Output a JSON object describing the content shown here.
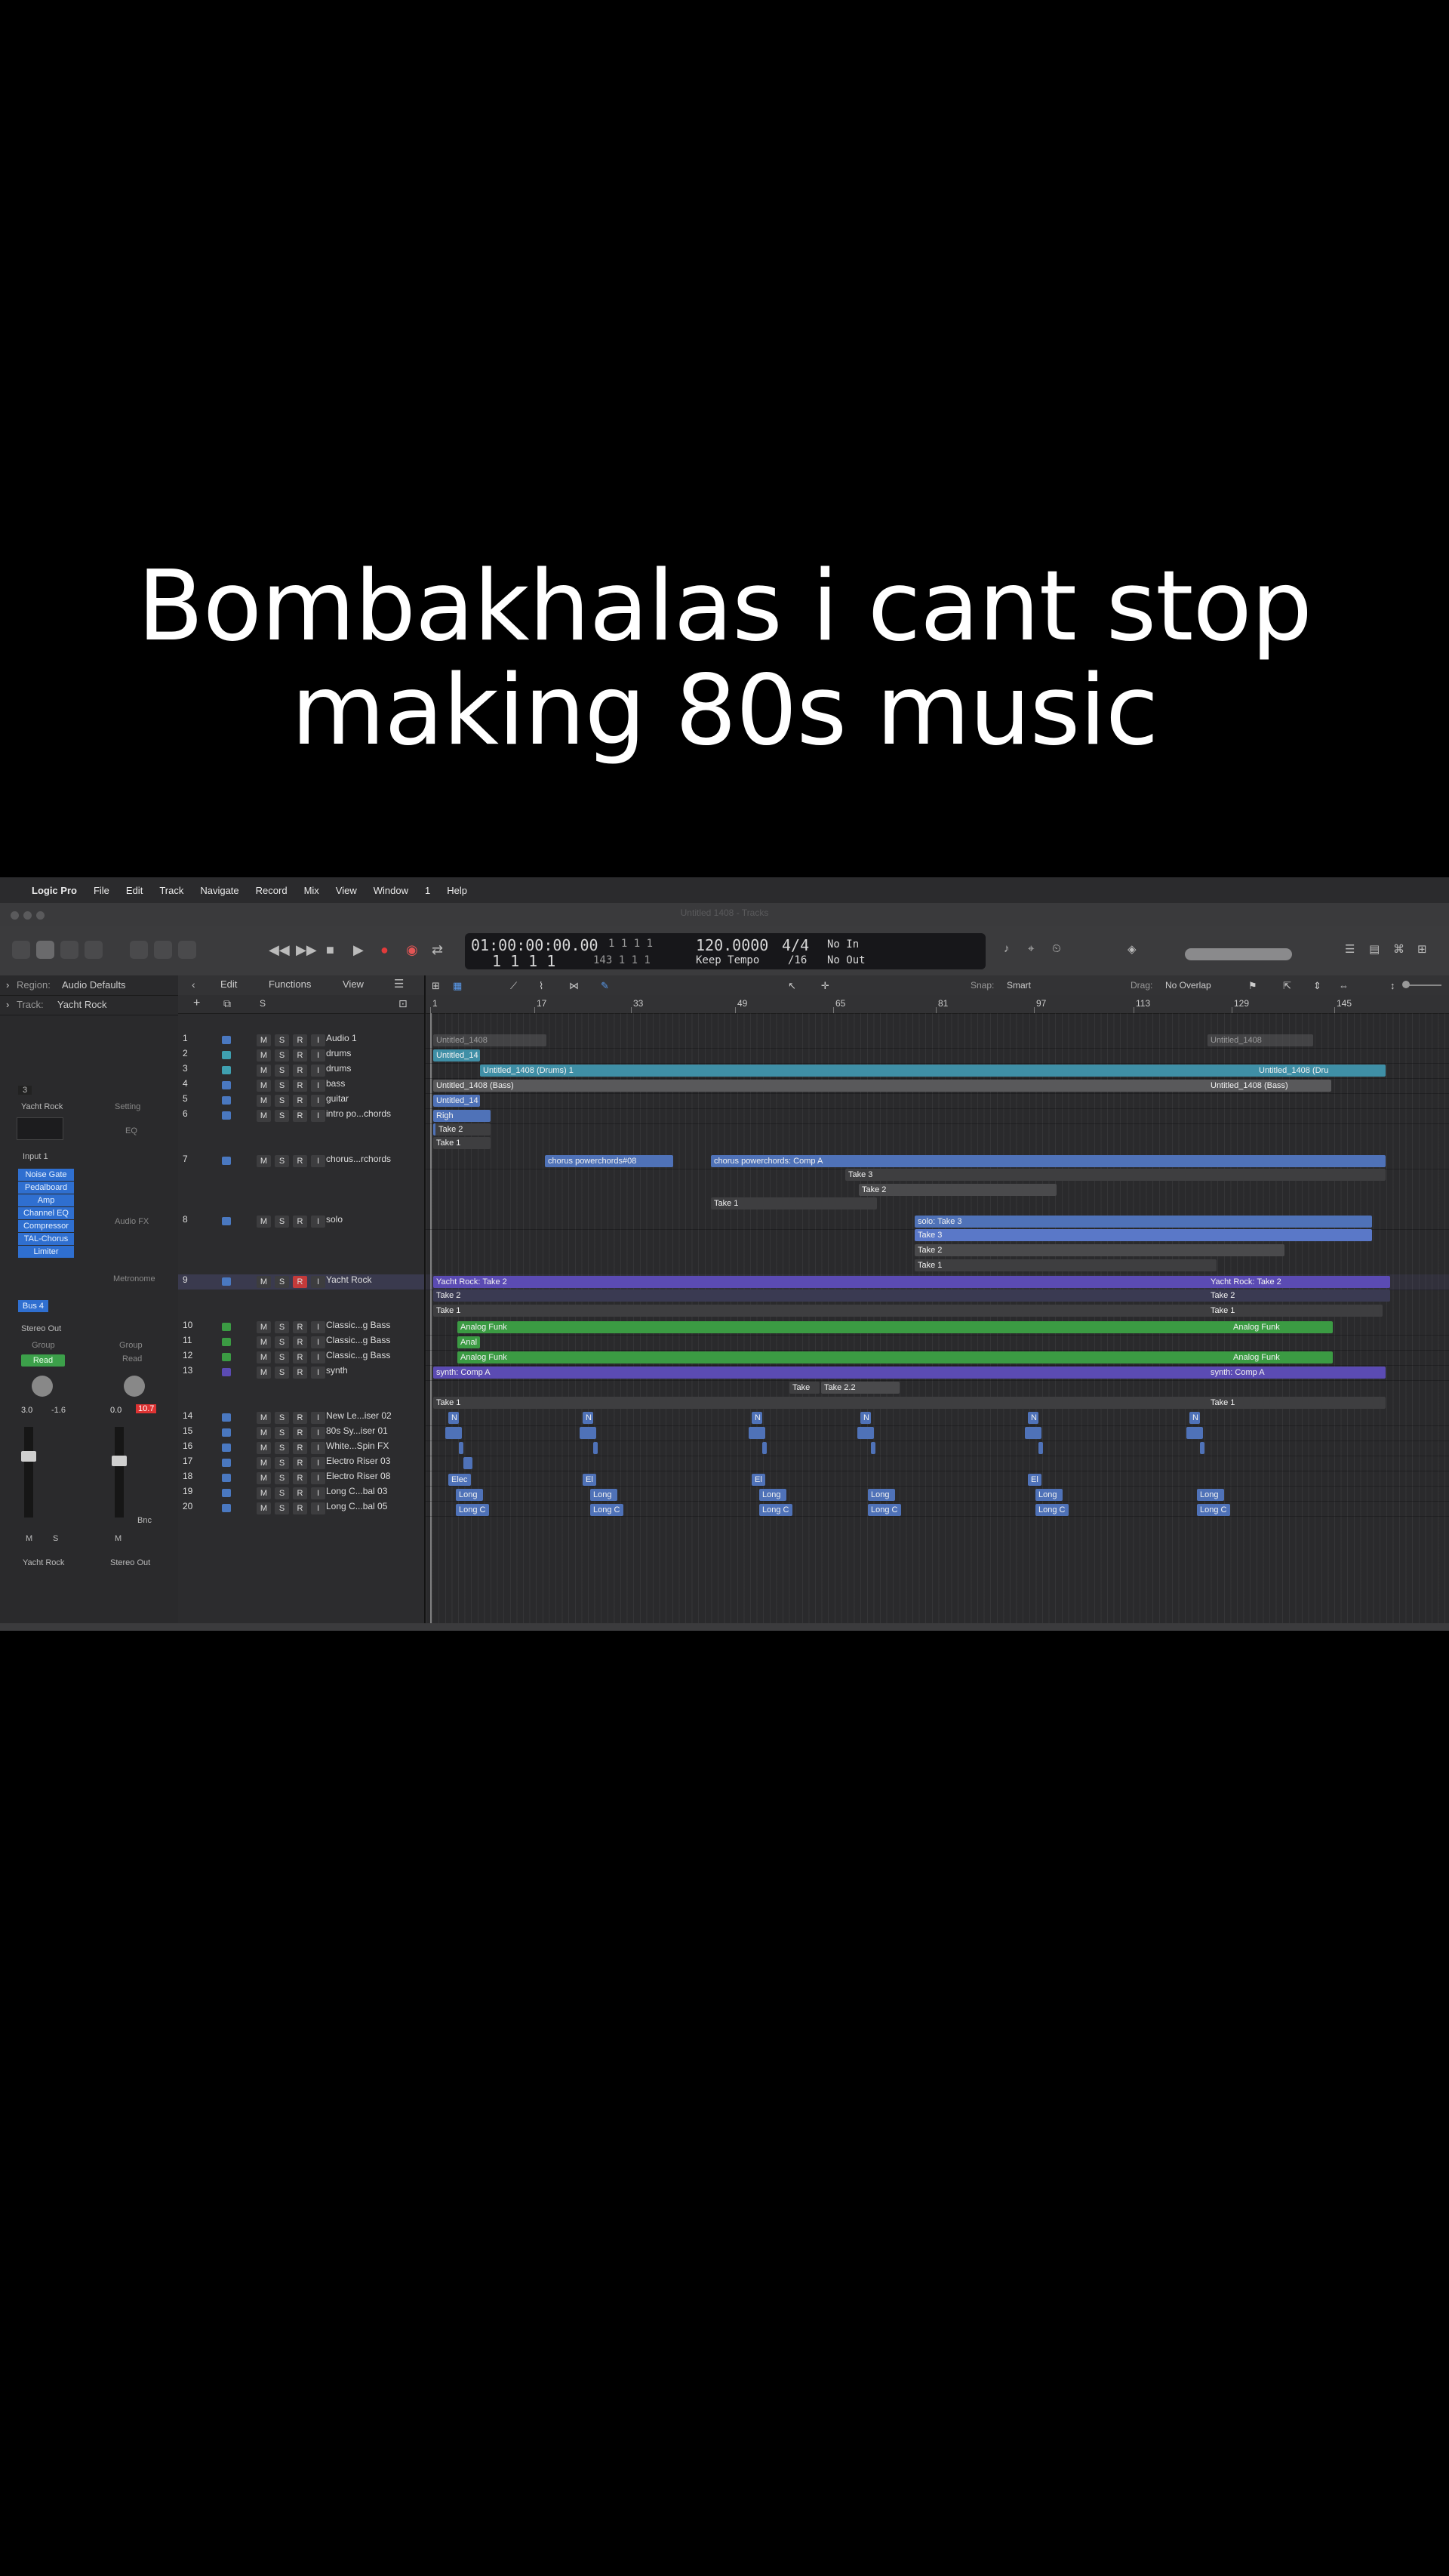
{
  "caption": {
    "line1": "Bombakhalas i cant stop",
    "line2": "making 80s music"
  },
  "menubar": {
    "app": "Logic Pro",
    "items": [
      "File",
      "Edit",
      "Track",
      "Navigate",
      "Record",
      "Mix",
      "View",
      "Window",
      "1",
      "Help"
    ]
  },
  "titlebar": {
    "title": "Untitled 1408 - Tracks"
  },
  "lcd": {
    "time": "01:00:00:00.00",
    "bars_top": "1  1  1     1",
    "bars_bottom": "1  1  1     1",
    "end_bars": "143  1  1     1",
    "tempo": "120.0000",
    "tempo_mode": "Keep Tempo",
    "signature": "4/4",
    "division": "/16",
    "in": "No In",
    "out": "No Out"
  },
  "inspector": {
    "region_label": "Region:",
    "region_value": "Audio Defaults",
    "track_label": "Track:",
    "track_value": "Yacht Rock",
    "strip1": {
      "name": "Yacht Rock",
      "input": "Input 1",
      "plugins": [
        "Noise Gate",
        "Pedalboard",
        "Amp",
        "Channel EQ",
        "Compressor",
        "TAL-Chorus",
        "Limiter"
      ],
      "send": "Bus 4",
      "output": "Stereo Out",
      "group": "Group",
      "automation": "Read",
      "vol": "3.0",
      "peak": "-1.6",
      "bottom_label": "Yacht Rock"
    },
    "strip2": {
      "setting": "Setting",
      "eq": "EQ",
      "audio_fx": "Audio FX",
      "metronome": "Metronome",
      "group": "Group",
      "automation": "Read",
      "vol": "0.0",
      "peak": "10.7",
      "bnc": "Bnc",
      "bottom_label": "Stereo Out"
    }
  },
  "arrange_toolbar": {
    "edit": "Edit",
    "functions": "Functions",
    "view": "View",
    "snap_label": "Snap:",
    "snap_value": "Smart",
    "drag_label": "Drag:",
    "drag_value": "No Overlap"
  },
  "ruler": [
    "1",
    "17",
    "33",
    "49",
    "65",
    "81",
    "97",
    "113",
    "129",
    "145"
  ],
  "colors": {
    "blue": "#4f72b8",
    "teal": "#3f8fa6",
    "purple": "#5b4bb3",
    "green": "#3b9b43",
    "gray": "#59595b",
    "accent": "#2f6fd0"
  },
  "tracks": [
    {
      "num": "1",
      "name": "Audio 1"
    },
    {
      "num": "2",
      "name": "drums"
    },
    {
      "num": "3",
      "name": "drums"
    },
    {
      "num": "4",
      "name": "bass"
    },
    {
      "num": "5",
      "name": "guitar"
    },
    {
      "num": "6",
      "name": "intro po...chords"
    },
    {
      "num": "7",
      "name": "chorus...rchords"
    },
    {
      "num": "8",
      "name": "solo"
    },
    {
      "num": "9",
      "name": "Yacht Rock"
    },
    {
      "num": "10",
      "name": "Classic...g Bass"
    },
    {
      "num": "11",
      "name": "Classic...g Bass"
    },
    {
      "num": "12",
      "name": "Classic...g Bass"
    },
    {
      "num": "13",
      "name": "synth"
    },
    {
      "num": "14",
      "name": "New Le...iser 02"
    },
    {
      "num": "15",
      "name": "80s Sy...iser 01"
    },
    {
      "num": "16",
      "name": "White...Spin FX"
    },
    {
      "num": "17",
      "name": "Electro Riser 03"
    },
    {
      "num": "18",
      "name": "Electro Riser 08"
    },
    {
      "num": "19",
      "name": "Long C...bal 03"
    },
    {
      "num": "20",
      "name": "Long C...bal 05"
    }
  ],
  "regions": {
    "r1a": "Untitled_1408",
    "r1b": "Untitled_1408",
    "r2": "Untitled_14",
    "r3a": "Untitled_1408 (Drums) 1",
    "r3b": "Untitled_1408 (Dru",
    "r4a": "Untitled_1408 (Bass)",
    "r4b": "Untitled_1408 (Bass)",
    "r5": "Untitled_14",
    "r6": "Righ",
    "r6t2": "Take 2",
    "r6t1": "Take 1",
    "r7a": "chorus powerchords#08",
    "r7b": "chorus powerchords: Comp A",
    "r7t3": "Take 3",
    "r7t2": "Take 2",
    "r7t1": "Take 1",
    "r8": "solo: Take 3",
    "r8t3": "Take 3",
    "r8t2": "Take 2",
    "r8t1": "Take 1",
    "r9a": "Yacht Rock: Take 2",
    "r9b": "Yacht Rock: Take 2",
    "r9t2": "Take 2",
    "r9t1": "Take 1",
    "r9t2b": "Take 2",
    "r9t1b": "Take 1",
    "r10a": "Analog Funk",
    "r10b": "Analog Funk",
    "r11": "Anal",
    "r12a": "Analog Funk",
    "r12b": "Analog Funk",
    "r13a": "synth: Comp A",
    "r13b": "synth: Comp A",
    "r13take": "Take",
    "r13t22": "Take 2.2",
    "r13t1": "Take 1",
    "r13t1b": "Take 1",
    "n": "N",
    "e": "El",
    "elec": "Elec",
    "long": "Long",
    "longc": "Long C"
  }
}
